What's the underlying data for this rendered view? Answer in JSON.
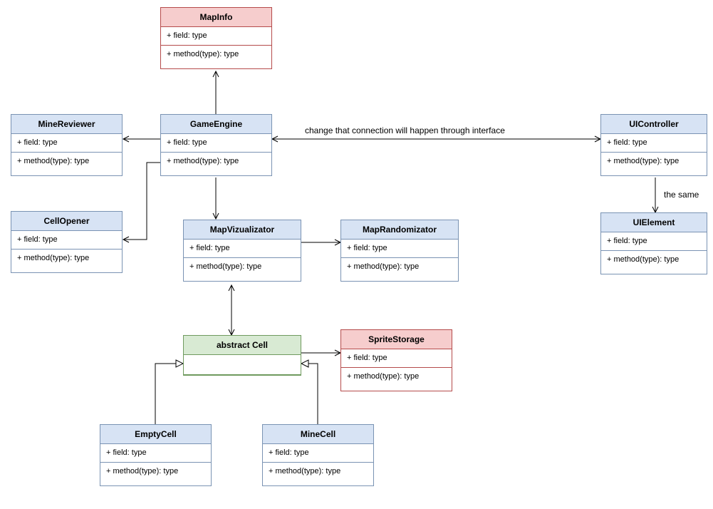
{
  "generic": {
    "field": "+ field: type",
    "method": "+ method(type): type"
  },
  "classes": {
    "mapInfo": {
      "title": "MapInfo"
    },
    "gameEngine": {
      "title": "GameEngine"
    },
    "mineReviewer": {
      "title": "MineReviewer"
    },
    "uiController": {
      "title": "UIController"
    },
    "uiElement": {
      "title": "UIElement"
    },
    "cellOpener": {
      "title": "CellOpener"
    },
    "mapVizualizator": {
      "title": "MapVizualizator"
    },
    "mapRandomizator": {
      "title": "MapRandomizator"
    },
    "abstractCell": {
      "title": "abstract Cell"
    },
    "spriteStorage": {
      "title": "SpriteStorage"
    },
    "emptyCell": {
      "title": "EmptyCell"
    },
    "mineCell": {
      "title": "MineCell"
    }
  },
  "labels": {
    "throughInterface": "change that connection will happen through interface",
    "theSame": "the same"
  },
  "chart_data": {
    "type": "uml-class-diagram",
    "nodes": [
      {
        "id": "MapInfo",
        "stereotype": "class",
        "color": "red",
        "fields": [
          "+ field: type"
        ],
        "methods": [
          "+ method(type): type"
        ]
      },
      {
        "id": "GameEngine",
        "stereotype": "class",
        "color": "blue",
        "fields": [
          "+ field: type"
        ],
        "methods": [
          "+ method(type): type"
        ]
      },
      {
        "id": "MineReviewer",
        "stereotype": "class",
        "color": "blue",
        "fields": [
          "+ field: type"
        ],
        "methods": [
          "+ method(type): type"
        ]
      },
      {
        "id": "UIController",
        "stereotype": "class",
        "color": "blue",
        "fields": [
          "+ field: type"
        ],
        "methods": [
          "+ method(type): type"
        ]
      },
      {
        "id": "UIElement",
        "stereotype": "class",
        "color": "blue",
        "fields": [
          "+ field: type"
        ],
        "methods": [
          "+ method(type): type"
        ]
      },
      {
        "id": "CellOpener",
        "stereotype": "class",
        "color": "blue",
        "fields": [
          "+ field: type"
        ],
        "methods": [
          "+ method(type): type"
        ]
      },
      {
        "id": "MapVizualizator",
        "stereotype": "class",
        "color": "blue",
        "fields": [
          "+ field: type"
        ],
        "methods": [
          "+ method(type): type"
        ]
      },
      {
        "id": "MapRandomizator",
        "stereotype": "class",
        "color": "blue",
        "fields": [
          "+ field: type"
        ],
        "methods": [
          "+ method(type): type"
        ]
      },
      {
        "id": "abstract Cell",
        "stereotype": "abstract-class",
        "color": "green",
        "fields": [],
        "methods": []
      },
      {
        "id": "SpriteStorage",
        "stereotype": "class",
        "color": "red",
        "fields": [
          "+ field: type"
        ],
        "methods": [
          "+ method(type): type"
        ]
      },
      {
        "id": "EmptyCell",
        "stereotype": "class",
        "color": "blue",
        "fields": [
          "+ field: type"
        ],
        "methods": [
          "+ method(type): type"
        ]
      },
      {
        "id": "MineCell",
        "stereotype": "class",
        "color": "blue",
        "fields": [
          "+ field: type"
        ],
        "methods": [
          "+ method(type): type"
        ]
      }
    ],
    "edges": [
      {
        "from": "GameEngine",
        "to": "MapInfo",
        "type": "association",
        "arrow": "open"
      },
      {
        "from": "GameEngine",
        "to": "MineReviewer",
        "type": "association",
        "arrow": "open"
      },
      {
        "from": "GameEngine",
        "to": "UIController",
        "type": "association",
        "arrow": "open-both",
        "label": "change that connection will happen through interface"
      },
      {
        "from": "GameEngine",
        "to": "MapVizualizator",
        "type": "association",
        "arrow": "open"
      },
      {
        "from": "GameEngine",
        "to": "CellOpener",
        "type": "association",
        "arrow": "open",
        "routing": "orthogonal"
      },
      {
        "from": "UIController",
        "to": "UIElement",
        "type": "association",
        "arrow": "open",
        "label": "the same"
      },
      {
        "from": "MapVizualizator",
        "to": "MapRandomizator",
        "type": "association",
        "arrow": "open"
      },
      {
        "from": "MapVizualizator",
        "to": "abstract Cell",
        "type": "association",
        "arrow": "open-both"
      },
      {
        "from": "abstract Cell",
        "to": "SpriteStorage",
        "type": "association",
        "arrow": "open"
      },
      {
        "from": "EmptyCell",
        "to": "abstract Cell",
        "type": "generalization",
        "arrow": "hollow-triangle"
      },
      {
        "from": "MineCell",
        "to": "abstract Cell",
        "type": "generalization",
        "arrow": "hollow-triangle"
      }
    ]
  }
}
